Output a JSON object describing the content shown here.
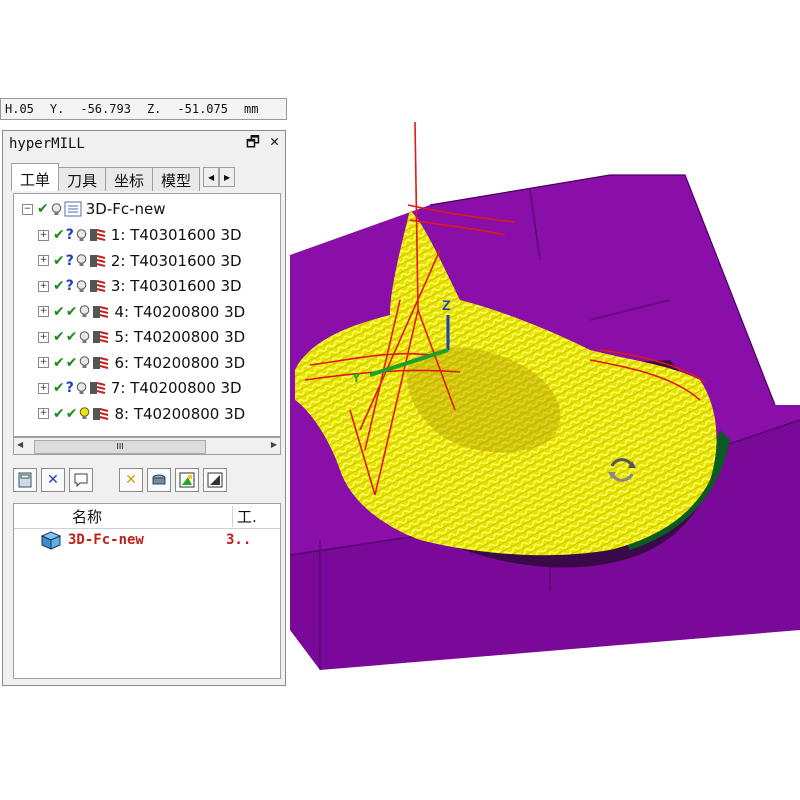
{
  "coordbar": {
    "v1": "H.05",
    "l2": "Y.",
    "v2": "-56.793",
    "l3": "Z.",
    "v3": "-51.075",
    "unit": "mm"
  },
  "panel": {
    "title": "hyperMILL",
    "pin_glyph": "🗗",
    "close_glyph": "✕",
    "tabs": [
      "工单",
      "刀具",
      "坐标",
      "模型"
    ],
    "tab_prev": "◀",
    "tab_next": "▶",
    "tree": {
      "root": {
        "label": "3D-Fc-new"
      },
      "items": [
        {
          "label": "1: T40301600 3D",
          "status": "?"
        },
        {
          "label": "2: T40301600 3D",
          "status": "?"
        },
        {
          "label": "3: T40301600 3D",
          "status": "?"
        },
        {
          "label": "4: T40200800 3D",
          "status": "✔"
        },
        {
          "label": "5: T40200800 3D",
          "status": "✔"
        },
        {
          "label": "6: T40200800 3D",
          "status": "✔"
        },
        {
          "label": "7: T40200800 3D",
          "status": "?"
        },
        {
          "label": "8: T40200800 3D",
          "status": "✔"
        }
      ]
    },
    "scroll_thumb": "III",
    "scroll_left": "◀",
    "scroll_right": "▶",
    "list": {
      "headers": [
        "名称",
        "工."
      ],
      "rows": [
        {
          "name": "3D-Fc-new",
          "value": "3.."
        }
      ]
    }
  },
  "viewport": {
    "axis_z": "Z",
    "axis_y": "Y"
  },
  "colors": {
    "part": "#8a0ea8",
    "toolpath": "#f5f000",
    "retract": "#e01818",
    "finished": "#0d5a22"
  }
}
